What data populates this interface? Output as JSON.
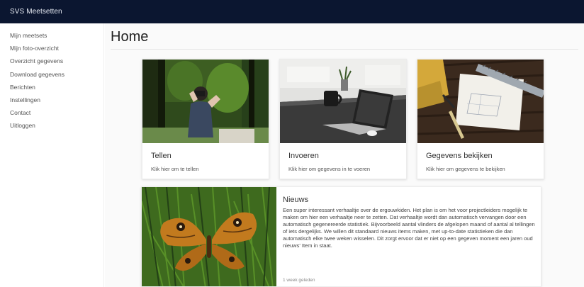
{
  "app": {
    "title": "SVS Meetsetten"
  },
  "sidebar": {
    "items": [
      {
        "label": "Mijn meetsets"
      },
      {
        "label": "Mijn foto-overzicht"
      },
      {
        "label": "Overzicht gegevens"
      },
      {
        "label": "Download gegevens"
      },
      {
        "label": "Berichten"
      },
      {
        "label": "Instellingen"
      },
      {
        "label": "Contact"
      },
      {
        "label": "Uitloggen"
      }
    ]
  },
  "main": {
    "title": "Home",
    "cards": [
      {
        "title": "Tellen",
        "text": "Klik hier om te tellen",
        "image": "person-with-binoculars-in-forest"
      },
      {
        "title": "Invoeren",
        "text": "Klik hier om gegevens in te voeren",
        "image": "laptop-on-desk"
      },
      {
        "title": "Gegevens bekijken",
        "text": "Klik hier om gegevens te bekijken",
        "image": "drawing-with-ruler-on-wood"
      }
    ],
    "news": {
      "title": "Nieuws",
      "text": "Een super interessant verhaaltje over de ergouwkiden. Het plan is om het voor projectleiders mogelijk te maken om hier een verhaaltje neer te zetten. Dat verhaaltje wordt dan automatisch vervangen door een automatisch gegenereerde statistiek. Bijvoorbeeld aantal vlinders de afgelopen maand of aantal al tellingen of iets dergelijks. We willen dit standaard nieuws items maken, met up-to-date statistieken die dan automatisch elke twee weken wisselen. Dit zorgt ervoor dat er niet op een gegeven moment een jaren oud nieuws' Item in staat.",
      "link": "1 week geleden",
      "image": "orange-butterfly-on-grass"
    }
  },
  "colors": {
    "topbar": "#0b1630",
    "background": "#fafafa"
  }
}
